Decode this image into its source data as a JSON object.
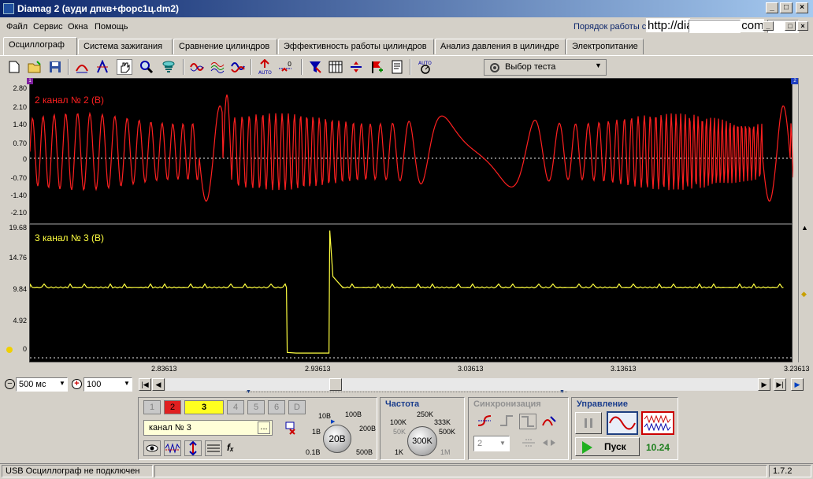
{
  "window": {
    "title": "Diamag 2 (ауди дпкв+форс1ц.dm2)"
  },
  "menu": [
    "Файл",
    "Сервис",
    "Окна",
    "Помощь"
  ],
  "header_link": "Порядок работы с программой",
  "url_text": "http://diamag-osc.com",
  "tabs": [
    {
      "label": "Осциллограф",
      "active": true
    },
    {
      "label": "Система зажигания"
    },
    {
      "label": "Сравнение цилиндров"
    },
    {
      "label": "Эффективность работы цилиндров"
    },
    {
      "label": "Анализ давления в цилиндре"
    },
    {
      "label": "Электропитание"
    }
  ],
  "toolbar": {
    "test_select": "Выбор теста",
    "auto_label": "AUTO"
  },
  "plot_top": {
    "label": "2  канал № 2 (В)",
    "yticks": [
      "2.80",
      "2.10",
      "1.40",
      "0.70",
      "0",
      "-0.70",
      "-1.40",
      "-2.10"
    ],
    "color": "#ff2020",
    "marker_left": "1",
    "marker_right": "2"
  },
  "plot_bottom": {
    "label": "3  канал № 3 (В)",
    "yticks": [
      "19.68",
      "14.76",
      "9.84",
      "4.92",
      "0"
    ],
    "color": "#ffff40"
  },
  "xaxis": {
    "ticks": [
      "2.83613",
      "2.93613",
      "3.03613",
      "3.13613",
      "3.23613"
    ]
  },
  "timebar": {
    "time_scale": "500 мс",
    "zoom": "100"
  },
  "channels": {
    "buttons": [
      "1",
      "2",
      "3",
      "4",
      "5",
      "6",
      "D"
    ],
    "selected": "канал № 3",
    "voltage_labels": [
      "10В",
      "100В",
      "1В",
      "200В",
      "0.1В",
      "500В"
    ],
    "voltage_value": "20В"
  },
  "frequency": {
    "title": "Частота",
    "labels": [
      "250K",
      "100K",
      "333K",
      "50K",
      "500K",
      "1K",
      "1M"
    ],
    "value": "300K"
  },
  "sync": {
    "title": "Синхронизация",
    "level": "2"
  },
  "control": {
    "title": "Управление",
    "start_label": "Пуск",
    "value": "10.24"
  },
  "status": {
    "left": "USB Осциллограф не подключен",
    "version": "1.7.2"
  },
  "chart_data": [
    {
      "type": "line",
      "label": "2  канал № 2 (В)",
      "ylim": [
        -2.5,
        3.0
      ],
      "yticks": [
        2.8,
        2.1,
        1.4,
        0.7,
        0,
        -0.7,
        -1.4,
        -2.1
      ],
      "xlim": [
        2.76,
        3.23613
      ]
    },
    {
      "type": "line",
      "label": "3  канал № 3 (В)",
      "ylim": [
        -0.8,
        19.68
      ],
      "yticks": [
        19.68,
        14.76,
        9.84,
        4.92,
        0
      ],
      "xlim": [
        2.76,
        3.23613
      ],
      "x": [
        2.76,
        2.92,
        2.9205,
        2.926,
        2.9465,
        2.947,
        2.949,
        2.955,
        3.23
      ],
      "values": [
        10.4,
        10.4,
        0.8,
        0.7,
        0.7,
        18.8,
        12.0,
        10.4,
        10.4
      ]
    }
  ]
}
